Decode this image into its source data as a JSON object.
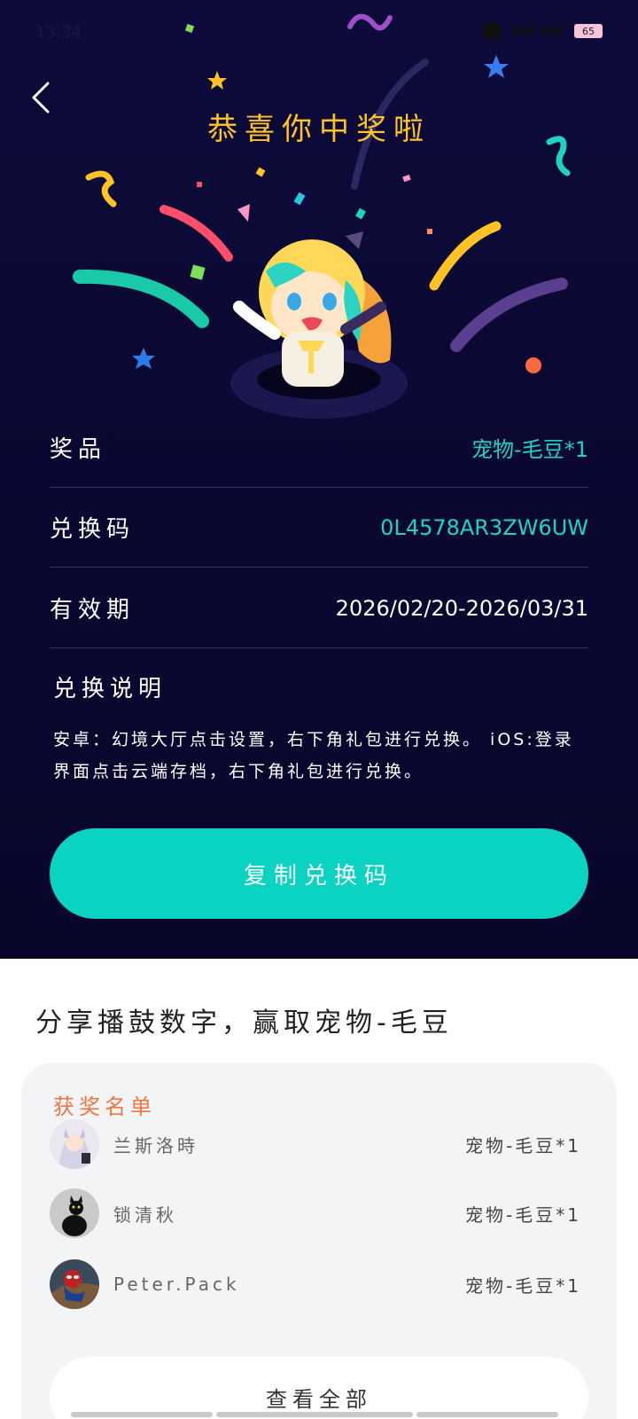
{
  "status_bar": {
    "time": "13:34",
    "battery": "65"
  },
  "header": {
    "title": "恭喜你中奖啦"
  },
  "info": {
    "prize_label": "奖品",
    "prize_value": "宠物-毛豆*1",
    "code_label": "兑换码",
    "code_value": "0L4578AR3ZW6UW",
    "validity_label": "有效期",
    "validity_value": "2026/02/20-2026/03/31",
    "desc_title": "兑换说明",
    "desc_text": "安卓：幻境大厅点击设置，右下角礼包进行兑换。 iOS:登录界面点击云端存档，右下角礼包进行兑换。"
  },
  "copy_button": "复制兑换码",
  "share": {
    "title": "分享播鼓数字，赢取宠物-毛豆"
  },
  "winners": {
    "title": "获奖名单",
    "list": [
      {
        "name": "兰斯洛時",
        "prize": "宠物-毛豆*1",
        "avatar": "anime-girl-avatar"
      },
      {
        "name": "锁清秋",
        "prize": "宠物-毛豆*1",
        "avatar": "black-cat-avatar"
      },
      {
        "name": "Peter.Pack",
        "prize": "宠物-毛豆*1",
        "avatar": "spiderman-avatar"
      }
    ],
    "view_all": "查看全部"
  },
  "colors": {
    "background": "#0d0b3a",
    "accent_teal": "#0ad3c1",
    "title_gold": "#ffc328",
    "winners_title": "#f0743e"
  }
}
